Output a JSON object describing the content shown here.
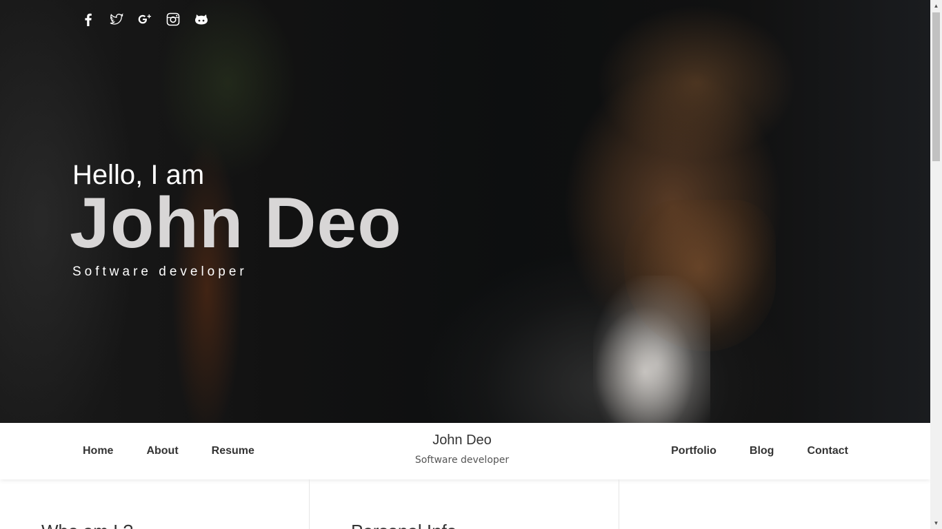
{
  "hero": {
    "greeting": "Hello, I am",
    "name": "John Deo",
    "role": "Software developer",
    "socials": [
      "facebook-icon",
      "twitter-icon",
      "google-plus-icon",
      "instagram-icon",
      "github-icon"
    ]
  },
  "nav": {
    "left": [
      "Home",
      "About",
      "Resume"
    ],
    "right": [
      "Portfolio",
      "Blog",
      "Contact"
    ],
    "brand_name": "John Deo",
    "brand_role": "Software developer"
  },
  "sections": {
    "who": "Who am I ?",
    "personal": "Personal Info"
  },
  "colors": {
    "hero_name": "#d8d6d6",
    "nav_text": "#333333",
    "divider": "#e6e6e6"
  }
}
